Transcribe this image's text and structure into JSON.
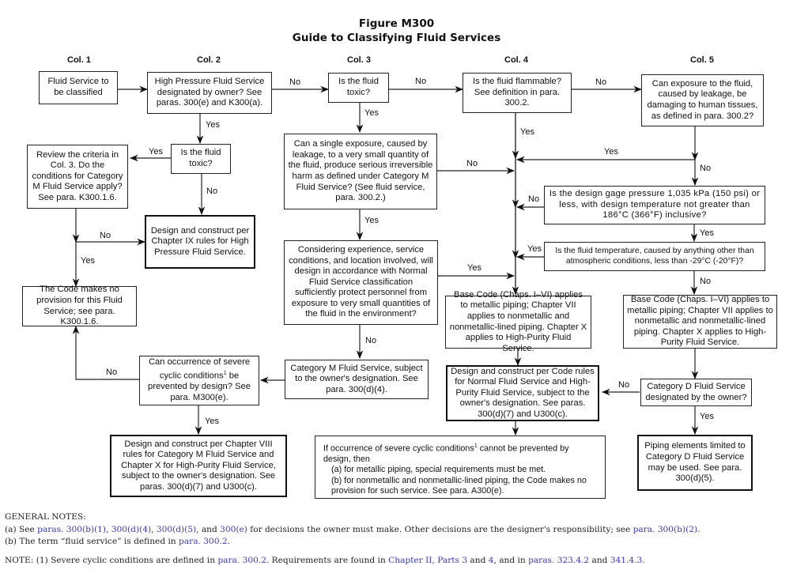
{
  "figure": {
    "number": "Figure M300",
    "title": "Guide to Classifying Fluid Services"
  },
  "columns": [
    "Col. 1",
    "Col. 2",
    "Col. 3",
    "Col. 4",
    "Col. 5"
  ],
  "nodes": {
    "start": "Fluid Service to be classified",
    "high_pressure_q": "High Pressure Fluid Service designated by owner? See paras. 300(e) and K300(a).",
    "col3_toxic_q": "Is the fluid toxic?",
    "flammable_q": "Is the fluid flammable? See definition in para. 300.2.",
    "tissue_damage_q": "Can exposure to the fluid, caused by leakage, be damaging to human tissues, as defined in para. 300.2?",
    "col2_toxic_q": "Is the fluid toxic?",
    "review_criteria_q": "Review the criteria in Col. 3. Do the conditions for Category M Fluid Service apply? See para. K300.1.6.",
    "chapter_ix_result": "Design and construct per Chapter IX rules for High Pressure Fluid Service.",
    "no_provision_result": "The Code makes no provision for this Fluid Service; see para. K300.1.6.",
    "single_exposure_q": "Can a single exposure, caused by leakage, to a very small quantity of the fluid, produce serious irreversible harm as defined under Category M Fluid Service? (See fluid service, para. 300.2.)",
    "normal_protect_q": "Considering experience, service conditions, and location involved, will design in accordance with Normal Fluid Service classification sufficiently protect personnel from exposure to very small quantities of the fluid in the environment?",
    "pressure_temp_q": "Is the design gage pressure 1,035 kPa (150 psi) or less, with design temperature not greater than 186°C (366°F) inclusive?",
    "low_temp_q": "Is the fluid temperature, caused by anything other than atmospheric conditions, less than -29°C (-20°F)?",
    "base_code_col4": "Base Code (Chaps. I–VI) applies to metallic piping; Chapter VII applies to nonmetallic and nonmetallic-lined piping. Chapter X applies to High-Purity Fluid Service.",
    "base_code_col5": "Base Code (Chaps. I–VI) applies to metallic piping; Chapter VII applies to nonmetallic and nonmetallic-lined piping. Chapter X applies to High-Purity Fluid Service.",
    "category_m_service": "Category M Fluid Service, subject to the owner's designation. See para. 300(d)(4).",
    "cyclic_q_pre": "Can occurrence of severe cyclic conditions",
    "cyclic_q_sup": "1",
    "cyclic_q_post": " be prevented by design? See para. M300(e).",
    "chapter_viii_result": "Design and construct per Chapter VIII rules for Category M Fluid Service and Chapter X for High-Purity Fluid Service, subject to the owner's designation. See paras. 300(d)(7) and U300(c).",
    "normal_result": "Design and construct per Code rules for Normal Fluid Service and High-Purity Fluid Service, subject to the owner's designation. See paras. 300(d)(7) and U300(c).",
    "category_d_q": "Category D Fluid Service designated by the owner?",
    "category_d_result": "Piping elements limited to Category D Fluid Service may be used. See para. 300(d)(5).",
    "severe_cyclic_note": {
      "line1_pre": "If occurrence of severe cyclic conditions",
      "line1_sup": "1",
      "line1_post": " cannot be prevented by design, then",
      "item_a": "(a)  for metallic piping, special requirements must be met.",
      "item_b": "(b)  for nonmetallic and nonmetallic-lined piping, the Code makes no provision for such service. See para. A300(e)."
    }
  },
  "edge_labels": {
    "yes": "Yes",
    "no": "No"
  },
  "notes": {
    "heading": "GENERAL NOTES:",
    "a": {
      "prefix": "(a)  See ",
      "links": [
        "paras. 300(b)(1)",
        "300(d)(4)",
        "300(d)(5)",
        "300(e)",
        "para. 300(b)(2)"
      ],
      "mid1": ", ",
      "mid2": ", ",
      "mid3": ", and ",
      "mid4": " for decisions the owner must make. Other decisions are the designer's responsibility; see ",
      "end": "."
    },
    "b": {
      "prefix": "(b)  The term “fluid service” is defined in ",
      "link": "para. 300.2",
      "end": "."
    },
    "note1": {
      "prefix": "NOTE:  (1) Severe cyclic conditions are defined in ",
      "link1": "para. 300.2",
      "mid1": ". Requirements are found in ",
      "link2": "Chapter II, Parts 3",
      "mid2": " and ",
      "link3": "4",
      "mid3": ", and in ",
      "link4": "paras. 323.4.2",
      "mid4": " and ",
      "link5": "341.4.3",
      "end": "."
    }
  },
  "colors": {
    "link": "#3a3ab8",
    "line": "#222222"
  }
}
